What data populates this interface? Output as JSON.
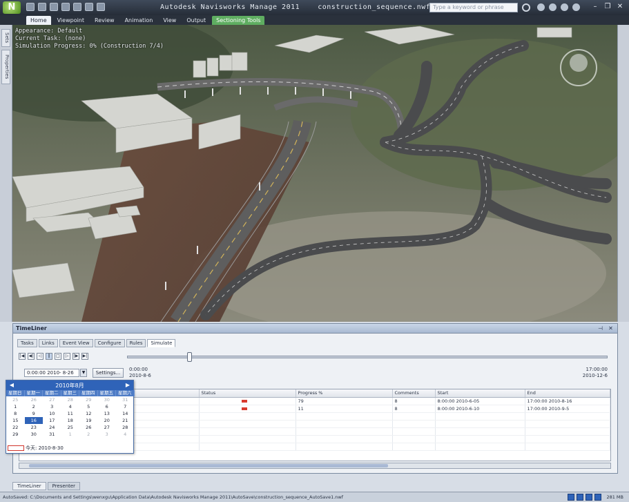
{
  "app": {
    "title": "Autodesk Navisworks Manage 2011",
    "document": "construction_sequence.nwf",
    "search_placeholder": "Type a keyword or phrase"
  },
  "ribbon": {
    "tabs": [
      "Home",
      "Viewpoint",
      "Review",
      "Animation",
      "View",
      "Output",
      "Sectioning Tools"
    ]
  },
  "viewport": {
    "overlay_lines": [
      "Appearance: Default",
      "Current Task: (none)",
      "Simulation Progress: 0% (Construction 7/4)"
    ]
  },
  "side_tabs": [
    "Sets",
    "Properties"
  ],
  "timeliner": {
    "title": "TimeLiner",
    "tabs": [
      "Tasks",
      "Links",
      "Event View",
      "Configure",
      "Rules",
      "Simulate"
    ],
    "active_tab": "Simulate",
    "start_time": "0:00:00\n2010-8-6",
    "end_time": "17:00:00\n2010-12-6",
    "date_value": "0:00:00 2010- 8-26",
    "settings_label": "Settings...",
    "columns": [
      "",
      "Status",
      "Progress %",
      "Comments",
      "Start",
      "End"
    ],
    "rows": [
      {
        "name": "",
        "progress": "79",
        "comments": "8",
        "start": "8:00:00 2010-6-05",
        "end": "17:00:00 2010-8-16"
      },
      {
        "name": "",
        "progress": "11",
        "comments": "8",
        "start": "8:00:00 2010-6-10",
        "end": "17:00:00 2010-9-5"
      }
    ]
  },
  "calendar": {
    "title": "2010年8月",
    "weekdays": [
      "星期日",
      "星期一",
      "星期二",
      "星期三",
      "星期四",
      "星期五",
      "星期六"
    ],
    "weeks": [
      [
        [
          "25",
          true
        ],
        [
          "26",
          true
        ],
        [
          "27",
          true
        ],
        [
          "28",
          true
        ],
        [
          "29",
          true
        ],
        [
          "30",
          true
        ],
        [
          "31",
          true
        ]
      ],
      [
        [
          "1",
          false
        ],
        [
          "2",
          false
        ],
        [
          "3",
          false
        ],
        [
          "4",
          false
        ],
        [
          "5",
          false
        ],
        [
          "6",
          false
        ],
        [
          "7",
          false
        ]
      ],
      [
        [
          "8",
          false
        ],
        [
          "9",
          false
        ],
        [
          "10",
          false
        ],
        [
          "11",
          false
        ],
        [
          "12",
          false
        ],
        [
          "13",
          false
        ],
        [
          "14",
          false
        ]
      ],
      [
        [
          "15",
          false
        ],
        [
          "16",
          false
        ],
        [
          "17",
          false
        ],
        [
          "18",
          false
        ],
        [
          "19",
          false
        ],
        [
          "20",
          false
        ],
        [
          "21",
          false
        ]
      ],
      [
        [
          "22",
          false
        ],
        [
          "23",
          false
        ],
        [
          "24",
          false
        ],
        [
          "25",
          false
        ],
        [
          "26",
          false
        ],
        [
          "27",
          false
        ],
        [
          "28",
          false
        ]
      ],
      [
        [
          "29",
          false
        ],
        [
          "30",
          false
        ],
        [
          "31",
          false
        ],
        [
          "1",
          true
        ],
        [
          "2",
          true
        ],
        [
          "3",
          true
        ],
        [
          "4",
          true
        ]
      ]
    ],
    "selected_day": "16",
    "today_label": "今天: 2010-8-30"
  },
  "bottom_tabs": [
    "TimeLiner",
    "Presenter"
  ],
  "status": {
    "path": "AutoSaved: C:\\Documents and Settings\\wenxgu\\Application Data\\Autodesk Navisworks Manage 2011\\AutoSave\\construction_sequence_AutoSave1.nwf",
    "size": "281 MB"
  },
  "colors": {
    "title_bar": "#2f3742",
    "accent": "#2f63b8",
    "context_tab": "#5fae61",
    "status_red": "#d83a2e"
  }
}
